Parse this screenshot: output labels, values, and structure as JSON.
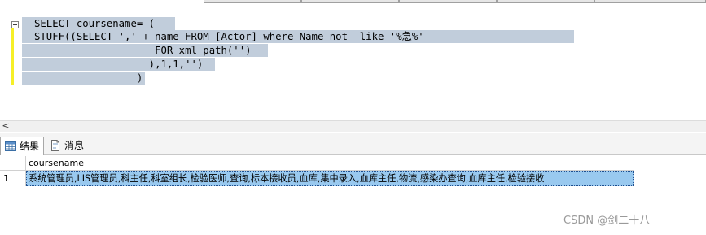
{
  "editor": {
    "lines": [
      "SELECT coursename= (",
      "STUFF((SELECT ',' + name FROM [Actor] where Name not  like '%急%'",
      "                    FOR xml path('')",
      "                   ),1,1,'')",
      "                 )"
    ]
  },
  "scrollbar": {
    "left_arrow": "<"
  },
  "result_tabs": {
    "results_label": "结果",
    "messages_label": "消息"
  },
  "grid": {
    "columns": [
      "coursename"
    ],
    "rows": [
      {
        "row_number": "1",
        "coursename": "系统管理员,LIS管理员,科主任,科室组长,检验医师,查询,标本接收员,血库,集中录入,血库主任,物流,感染办查询,血库主任,检验接收"
      }
    ]
  },
  "watermark": "CSDN @剑二十八",
  "colors": {
    "selection": "#c1cddb",
    "change_bar": "#f6ef27",
    "selected_cell": "#99c9ef"
  }
}
